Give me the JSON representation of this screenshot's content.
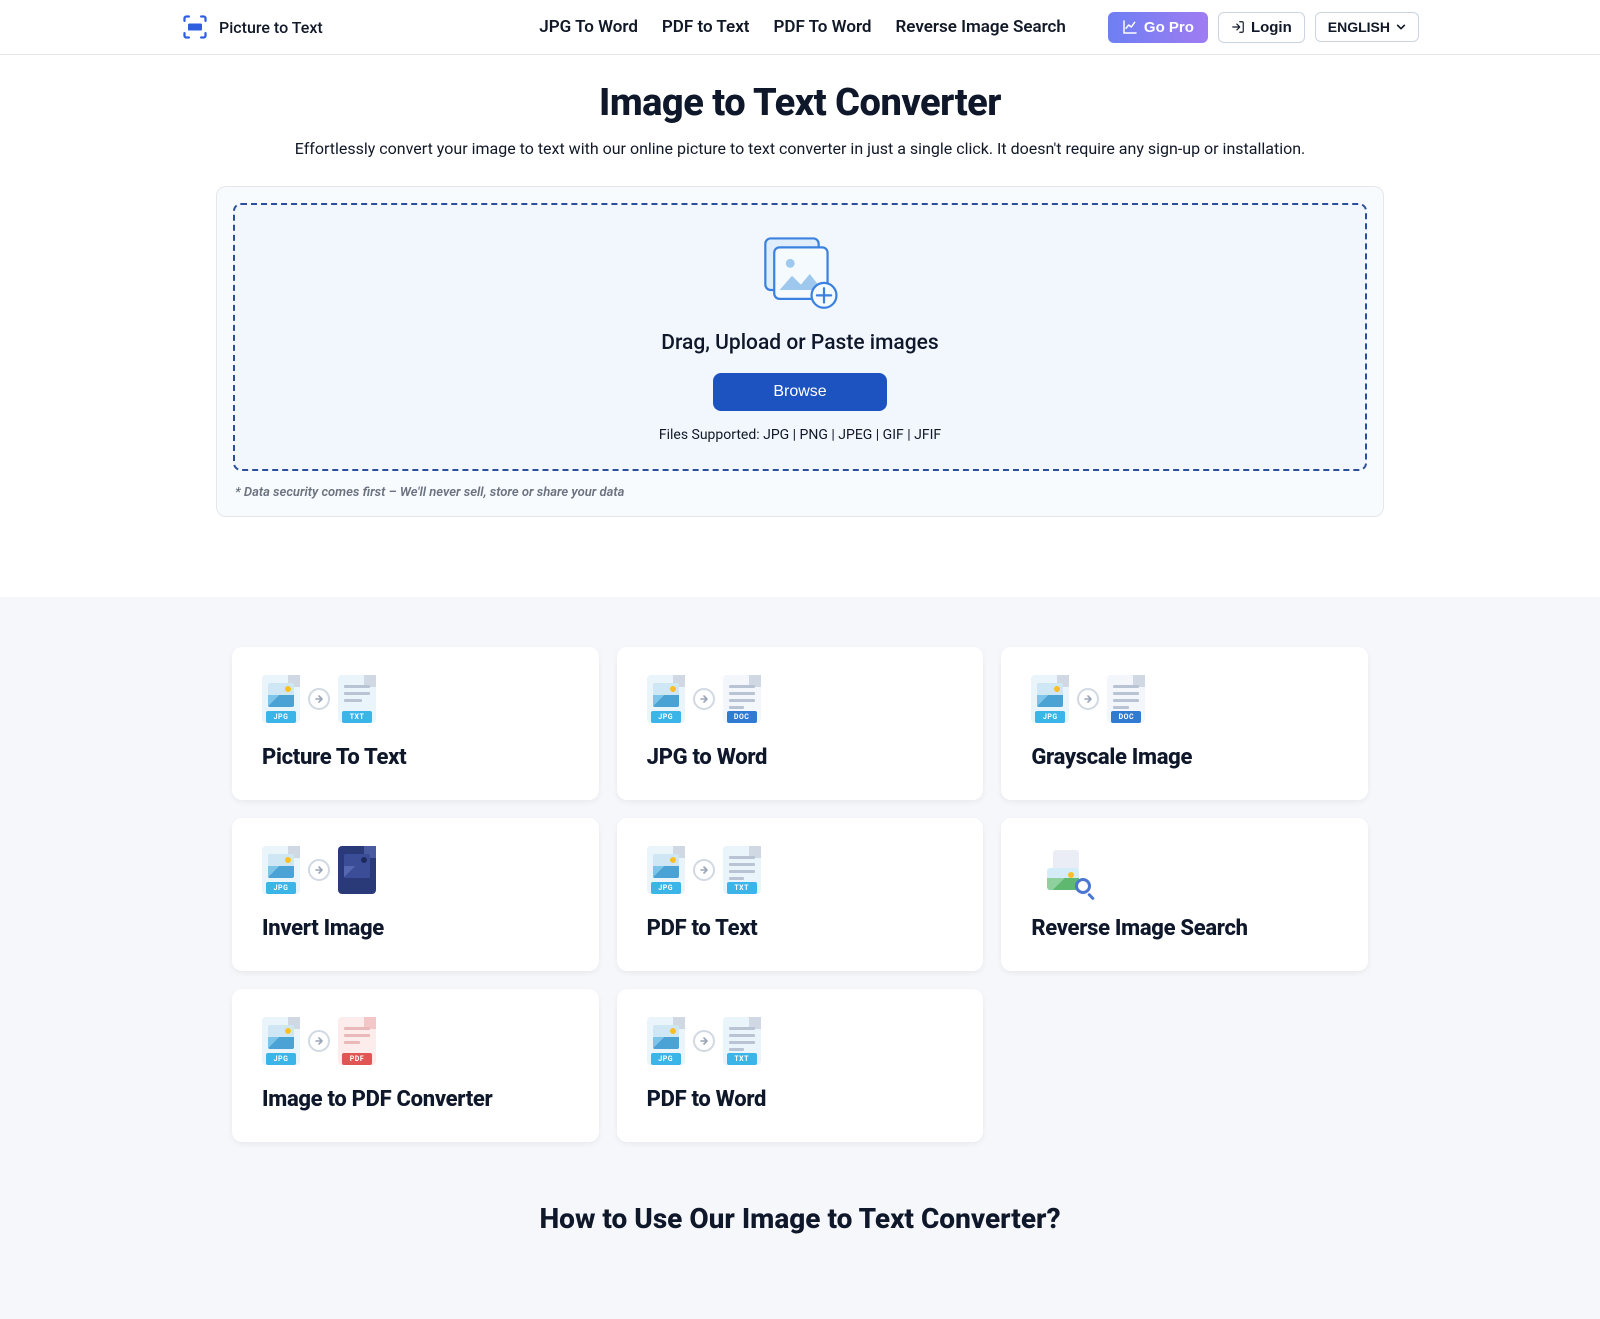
{
  "header": {
    "brand": "Picture to Text",
    "nav": {
      "jpg_to_word": "JPG To Word",
      "pdf_to_text": "PDF to Text",
      "pdf_to_word": "PDF To Word",
      "reverse_image_search": "Reverse Image Search"
    },
    "go_pro": "Go Pro",
    "login": "Login",
    "language": "ENGLISH"
  },
  "hero": {
    "title": "Image to Text Converter",
    "subtitle": "Effortlessly convert your image to text with our online picture to text converter in just a single click. It doesn't require any sign-up or installation."
  },
  "uploader": {
    "headline": "Drag, Upload or Paste images",
    "browse_label": "Browse",
    "supported": "Files Supported: JPG | PNG | JPEG | GIF | JFIF",
    "security_note": "* Data security comes first – We'll never sell, store or share your data"
  },
  "cards": {
    "picture_to_text": "Picture To Text",
    "jpg_to_word": "JPG to Word",
    "grayscale_image": "Grayscale Image",
    "invert_image": "Invert Image",
    "pdf_to_text": "PDF to Text",
    "reverse_image_search": "Reverse Image Search",
    "image_to_pdf": "Image to PDF Converter",
    "pdf_to_word": "PDF to Word"
  },
  "howto_heading": "How to Use Our Image to Text Converter?",
  "colors": {
    "tag_jpg": "#3bb4e7",
    "tag_txt": "#3bb4e7",
    "tag_doc": "#2f7bd1",
    "tag_pdf": "#e25555"
  }
}
